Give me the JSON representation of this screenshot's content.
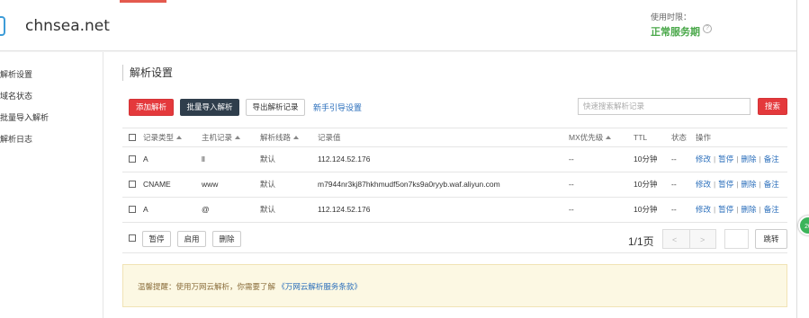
{
  "header": {
    "domain": "chnsea.net",
    "usage_label": "使用时限：",
    "status": "正常服务期",
    "help_icon": "?"
  },
  "sidebar": {
    "items": [
      {
        "label": "解析设置",
        "active": true
      },
      {
        "label": "域名状态"
      },
      {
        "label": "批量导入解析"
      },
      {
        "label": "解析日志"
      }
    ]
  },
  "main": {
    "title": "解析设置",
    "buttons": {
      "add": "添加解析",
      "bulk_import": "批量导入解析",
      "export": "导出解析记录",
      "guide": "新手引导设置",
      "search": "搜索"
    },
    "search": {
      "placeholder": "快速搜索解析记录"
    },
    "table": {
      "headers": {
        "type": "记录类型",
        "host": "主机记录",
        "line": "解析线路",
        "value": "记录值",
        "mx": "MX优先级",
        "ttl": "TTL",
        "status": "状态",
        "ops": "操作"
      },
      "rows": [
        {
          "type": "A",
          "host": "ll",
          "line": "默认",
          "value": "112.124.52.176",
          "mx": "--",
          "ttl": "10分钟",
          "status": "--"
        },
        {
          "type": "CNAME",
          "host": "www",
          "line": "默认",
          "value": "m7944nr3kj87hkhmudf5on7ks9a0ryyb.waf.aliyun.com",
          "mx": "--",
          "ttl": "10分钟",
          "status": "--"
        },
        {
          "type": "A",
          "host": "@",
          "line": "默认",
          "value": "112.124.52.176",
          "mx": "--",
          "ttl": "10分钟",
          "status": "--"
        }
      ],
      "actions": {
        "edit": "修改",
        "pause": "暂停",
        "delete": "删除",
        "note": "备注"
      }
    },
    "footer": {
      "pause": "暂停",
      "enable": "启用",
      "delete": "删除",
      "pager": "1/1页",
      "prev": "<",
      "next": ">",
      "jump": "跳转"
    },
    "notice": {
      "prefix": "温馨提醒：使用万网云解析，你需要了解",
      "link": "《万网云解析服务条款》"
    }
  },
  "float_badge": "20",
  "colors": {
    "accent_red": "#e4393c",
    "dark_button": "#2f3e4c",
    "link": "#2a6ebb",
    "status_green": "#4aa84a"
  }
}
